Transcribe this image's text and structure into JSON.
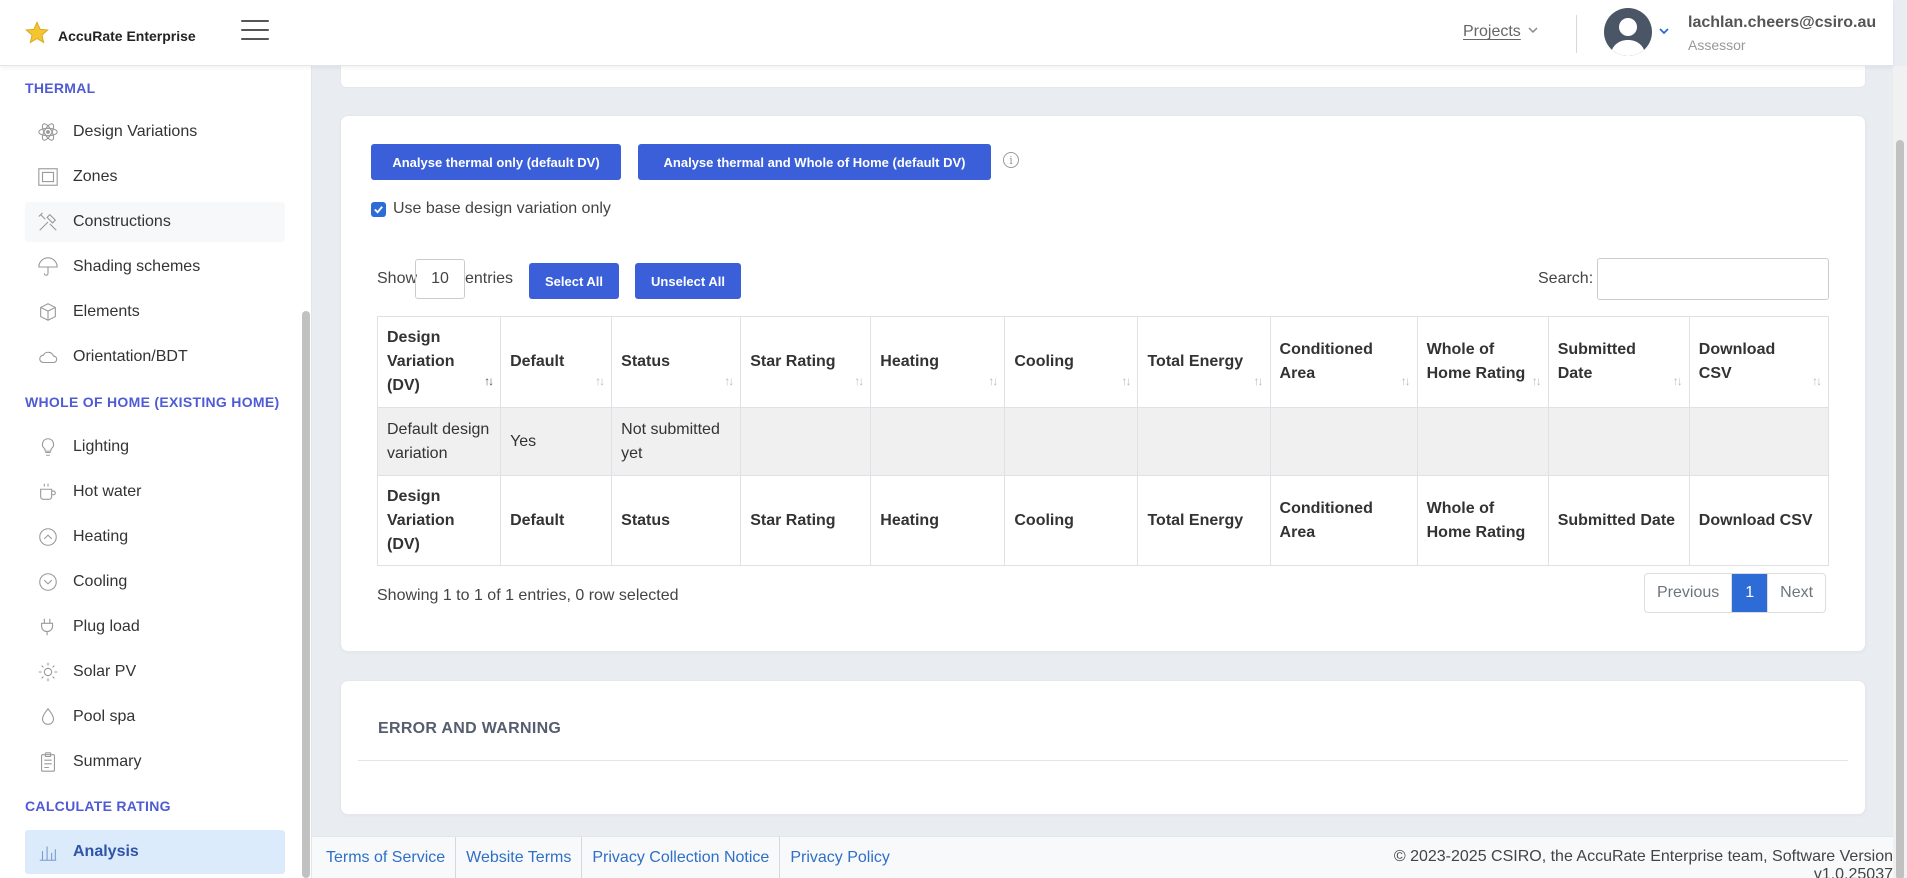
{
  "header": {
    "app_name": "AccuRate Enterprise",
    "projects_label": "Projects",
    "user_email": "lachlan.cheers@csiro.au",
    "user_role": "Assessor"
  },
  "sidebar": {
    "sections": {
      "thermal": "THERMAL",
      "whole_of_home": "WHOLE OF HOME (EXISTING HOME)",
      "calculate": "CALCULATE RATING"
    },
    "thermal_items": [
      {
        "label": "Design Variations",
        "icon": "atom-icon"
      },
      {
        "label": "Zones",
        "icon": "zones-icon"
      },
      {
        "label": "Constructions",
        "icon": "tools-icon"
      },
      {
        "label": "Shading schemes",
        "icon": "umbrella-icon"
      },
      {
        "label": "Elements",
        "icon": "boxes-icon"
      },
      {
        "label": "Orientation/BDT",
        "icon": "cloud-icon"
      }
    ],
    "woh_items": [
      {
        "label": "Lighting",
        "icon": "bulb-icon"
      },
      {
        "label": "Hot water",
        "icon": "mug-icon"
      },
      {
        "label": "Heating",
        "icon": "chevron-up-circle-icon"
      },
      {
        "label": "Cooling",
        "icon": "chevron-down-circle-icon"
      },
      {
        "label": "Plug load",
        "icon": "plug-icon"
      },
      {
        "label": "Solar PV",
        "icon": "sun-icon"
      },
      {
        "label": "Pool spa",
        "icon": "drop-icon"
      },
      {
        "label": "Summary",
        "icon": "clipboard-icon"
      }
    ],
    "calc_items": [
      {
        "label": "Analysis",
        "icon": "bar-chart-icon"
      }
    ]
  },
  "actions": {
    "analyse_thermal": "Analyse thermal only (default DV)",
    "analyse_woh": "Analyse thermal and Whole of Home (default DV)",
    "info_glyph": "i",
    "use_base_dv_label": "Use base design variation only",
    "use_base_dv_checked": true
  },
  "table_controls": {
    "show_label": "Show",
    "entries_value": "10",
    "entries_label": "entries",
    "select_all": "Select All",
    "unselect_all": "Unselect All",
    "search_label": "Search:",
    "search_value": ""
  },
  "table": {
    "headers": [
      "Design Variation (DV)",
      "Default",
      "Status",
      "Star Rating",
      "Heating",
      "Cooling",
      "Total Energy",
      "Conditioned Area",
      "Whole of Home Rating",
      "Submitted Date",
      "Download CSV"
    ],
    "rows": [
      [
        "Default design variation",
        "Yes",
        "Not submitted yet",
        "",
        "",
        "",
        "",
        "",
        "",
        "",
        ""
      ]
    ],
    "info": "Showing 1 to 1 of 1 entries, 0 row selected",
    "pagination": {
      "previous": "Previous",
      "current": "1",
      "next": "Next"
    }
  },
  "errors": {
    "title": "ERROR AND WARNING"
  },
  "footer": {
    "links": [
      "Terms of Service",
      "Website Terms",
      "Privacy Collection Notice",
      "Privacy Policy"
    ],
    "copyright": "© 2023-2025 CSIRO, the AccuRate Enterprise team, Software Version v1.0.25037"
  },
  "colors": {
    "primary": "#3a5fd9",
    "section": "#4f5bd5",
    "link": "#2f6fc5",
    "active_bg": "#dbebfb"
  }
}
